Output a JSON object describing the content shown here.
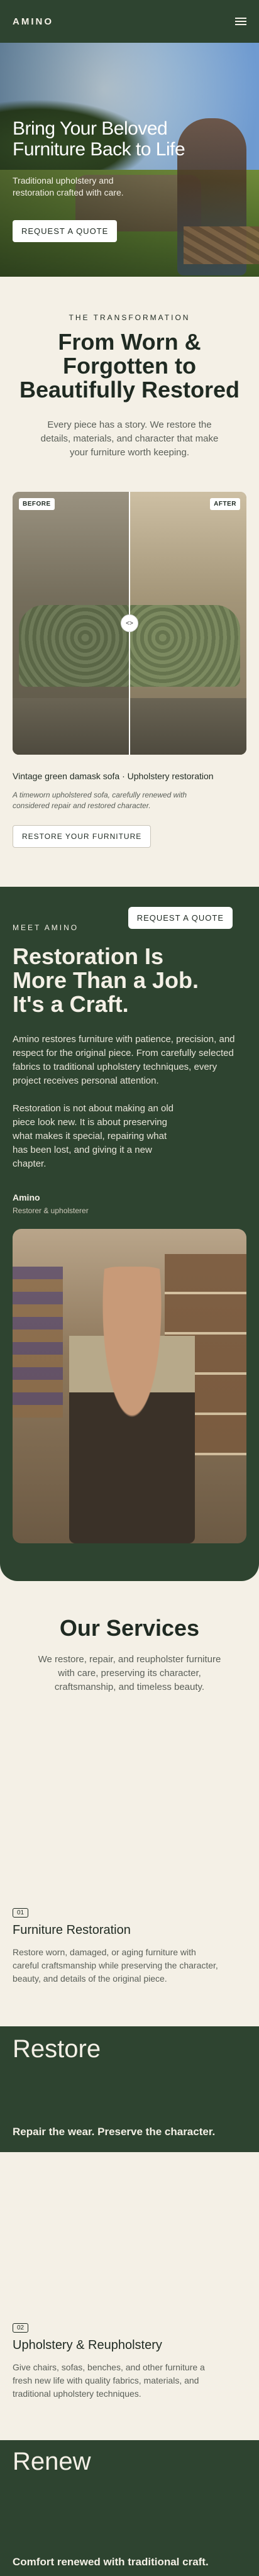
{
  "nav": {
    "logo": "AMINO"
  },
  "hero": {
    "title": "Bring Your Beloved Furniture Back to Life",
    "subtitle": "Traditional upholstery and restoration crafted with care.",
    "cta": "REQUEST A QUOTE"
  },
  "transformation": {
    "eyebrow": "THE TRANSFORMATION",
    "title": "From Worn & Forgotten to Beautifully Restored",
    "subtitle": "Every piece has a story. We restore the details, materials, and character that make your furniture worth keeping.",
    "before_label": "BEFORE",
    "after_label": "AFTER",
    "handle": "<>",
    "caption_title": "Vintage green damask sofa · Upholstery restoration",
    "caption_desc": "A timeworn upholstered sofa, carefully renewed with considered repair and restored character.",
    "cta": "RESTORE YOUR FURNITURE"
  },
  "meet": {
    "eyebrow": "MEET AMINO",
    "title": "Restoration Is More Than a Job. It's a Craft.",
    "p1": "Amino restores furniture with patience, precision, and respect for the original piece. From carefully selected fabrics to traditional upholstery techniques, every project receives personal attention.",
    "p2": "Restoration is not about making an old piece look new. It is about preserving what makes it special, repairing what has been lost, and giving it a new chapter.",
    "name": "Amino",
    "role": "Restorer & upholsterer",
    "cta": "REQUEST A QUOTE"
  },
  "services": {
    "title": "Our Services",
    "subtitle": "We restore, repair, and reupholster furniture with care, preserving its character, craftsmanship, and timeless beauty.",
    "items": [
      {
        "number": "01",
        "name": "Furniture Restoration",
        "desc": "Restore worn, damaged, or aging furniture with careful craftsmanship while preserving the character, beauty, and details of the original piece.",
        "band_word": "Restore",
        "band_tagline": "Repair the wear. Preserve the character."
      },
      {
        "number": "02",
        "name": "Upholstery & Reupholstery",
        "desc": "Give chairs, sofas, benches, and other furniture a fresh new life with quality fabrics, materials, and traditional upholstery techniques.",
        "band_word": "Renew",
        "band_tagline": "Comfort renewed with traditional craft."
      }
    ]
  },
  "colors": {
    "primary": "#2e4430",
    "background": "#f4f0e6",
    "text": "#1f2a22"
  }
}
